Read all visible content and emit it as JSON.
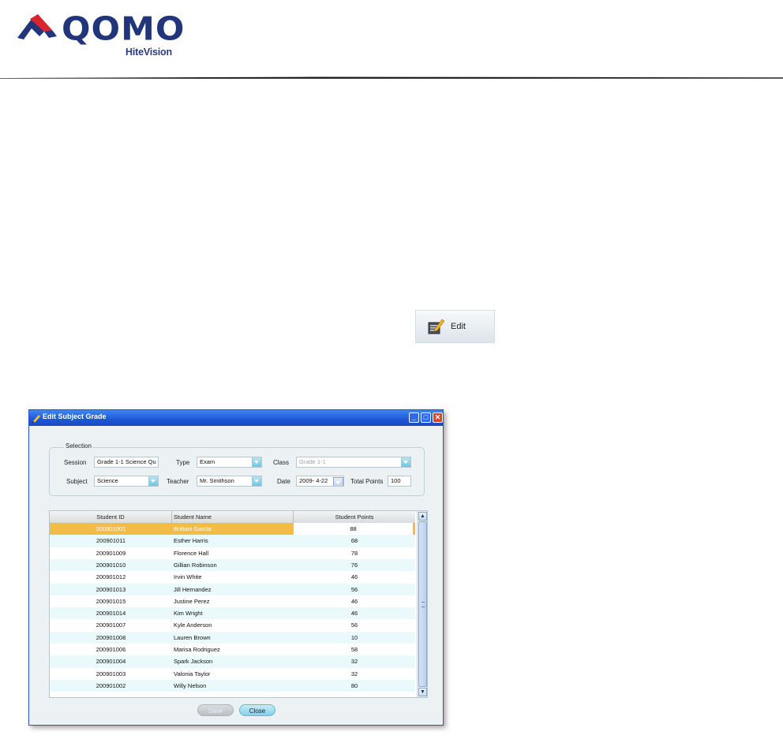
{
  "header": {
    "brand": "QOMO",
    "brand_sub": "HiteVision",
    "brand_colors": {
      "navy": "#21357a",
      "red": "#d8262f"
    }
  },
  "toolbar": {
    "edit_label": "Edit",
    "edit_icon": "edit-pencil-notepad-icon"
  },
  "dialog": {
    "title": "Edit Subject Grade",
    "window_buttons": {
      "minimize": "_",
      "maximize": "□",
      "close": "✕"
    },
    "selection": {
      "legend": "Selection",
      "session_label": "Session",
      "session_value": "Grade 1-1 Science Qu",
      "type_label": "Type",
      "type_value": "Exam",
      "class_label": "Class",
      "class_value": "Grade 1-1",
      "subject_label": "Subject",
      "subject_value": "Science",
      "teacher_label": "Teacher",
      "teacher_value": "Mr. Smithson",
      "date_label": "Date",
      "date_value": "2009- 4-22",
      "total_points_label": "Total Points",
      "total_points_value": "100"
    },
    "table": {
      "headers": [
        "Student ID",
        "Student Name",
        "Student Points"
      ],
      "selected_row_color": "#f4bc45",
      "alt_row_color": "#eaf9fb",
      "rows": [
        {
          "id": "200901001",
          "name": "Brittani Garcia",
          "points": "88"
        },
        {
          "id": "200901011",
          "name": "Esther Harris",
          "points": "68"
        },
        {
          "id": "200901009",
          "name": "Florence Hall",
          "points": "78"
        },
        {
          "id": "200901010",
          "name": "Gillian Robinson",
          "points": "76"
        },
        {
          "id": "200901012",
          "name": "Irvin White",
          "points": "46"
        },
        {
          "id": "200901013",
          "name": "Jill Hernandez",
          "points": "56"
        },
        {
          "id": "200901015",
          "name": "Justine Perez",
          "points": "46"
        },
        {
          "id": "200901014",
          "name": "Kim Wright",
          "points": "46"
        },
        {
          "id": "200901007",
          "name": "Kyle Anderson",
          "points": "56"
        },
        {
          "id": "200901008",
          "name": "Lauren Brown",
          "points": "10"
        },
        {
          "id": "200901006",
          "name": "Marisa Rodriguez",
          "points": "58"
        },
        {
          "id": "200901004",
          "name": "Spark Jackson",
          "points": "32"
        },
        {
          "id": "200901003",
          "name": "Valonia Taylor",
          "points": "32"
        },
        {
          "id": "200901002",
          "name": "Willy Nelson",
          "points": "80"
        }
      ]
    },
    "buttons": {
      "save": "Save",
      "close": "Close"
    }
  }
}
